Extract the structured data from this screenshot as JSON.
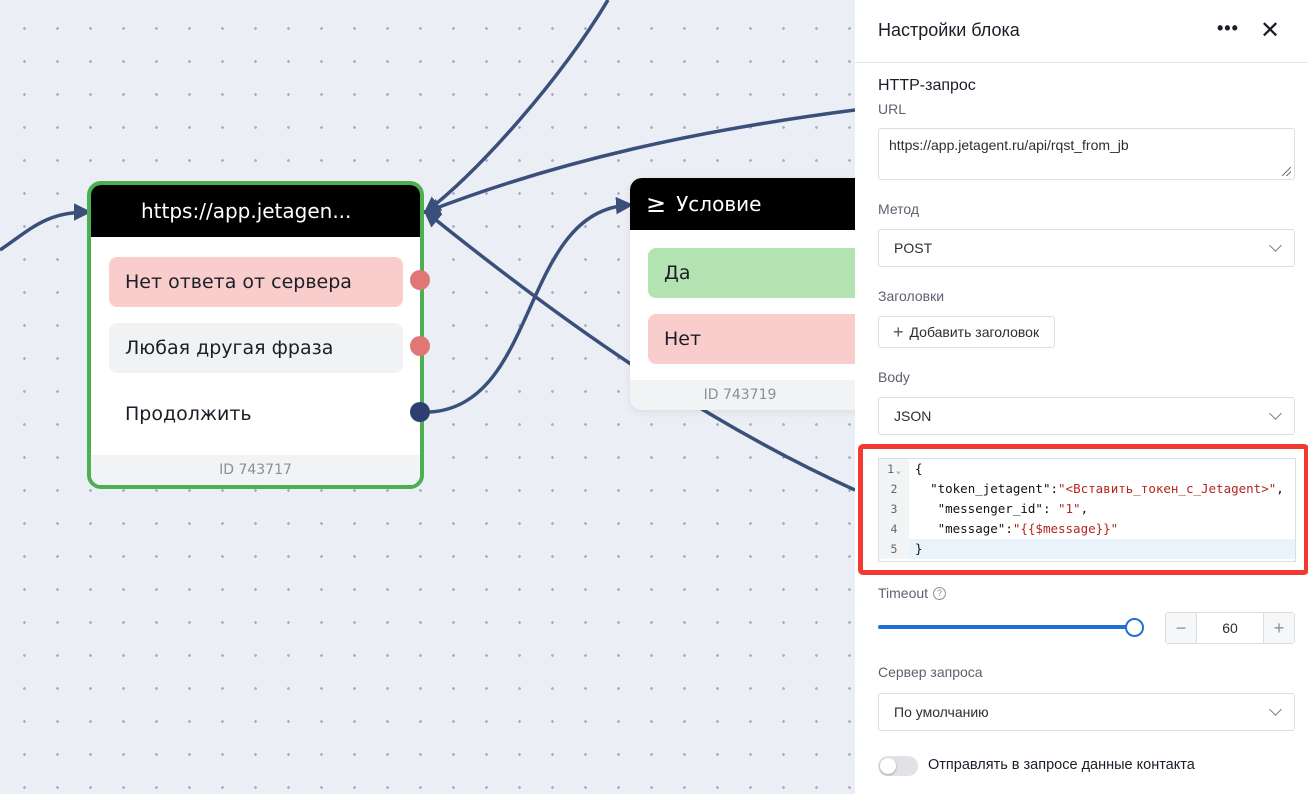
{
  "canvas": {
    "http_node": {
      "title": "https://app.jetagen...",
      "options": [
        "Нет ответа от сервера",
        "Любая другая фраза",
        "Продолжить"
      ],
      "id_label": "ID 743717"
    },
    "condition_node": {
      "icon": "greater-equal-icon",
      "title": "Условие",
      "options": [
        "Да",
        "Нет"
      ],
      "id_label": "ID 743719"
    }
  },
  "panel": {
    "title": "Настройки блока",
    "section": "HTTP-запрос",
    "url_label": "URL",
    "url_value": "https://app.jetagent.ru/api/rqst_from_jb",
    "method_label": "Метод",
    "method_value": "POST",
    "headers_label": "Заголовки",
    "add_header_label": "Добавить заголовок",
    "body_label": "Body",
    "body_value": "JSON",
    "code_lines": [
      "{",
      "  \"token_jetagent\":\"<Вставить_токен_с_Jetagent>\",",
      "   \"messenger_id\": \"1\",",
      "   \"message\":\"{{$message}}\"",
      "}"
    ],
    "line_numbers": [
      "1",
      "2",
      "3",
      "4",
      "5"
    ],
    "timeout_label": "Timeout",
    "timeout_value": "60",
    "timeout_fraction": 1.0,
    "server_label": "Сервер запроса",
    "server_value": "По умолчанию",
    "contact_toggle_label": "Отправлять в запросе данные контакта",
    "contact_toggle_on": false
  },
  "colors": {
    "accent": "#1f6fd4",
    "highlight": "#f23a33",
    "node_border": "#4caf50",
    "wire": "#3a4f7a"
  }
}
